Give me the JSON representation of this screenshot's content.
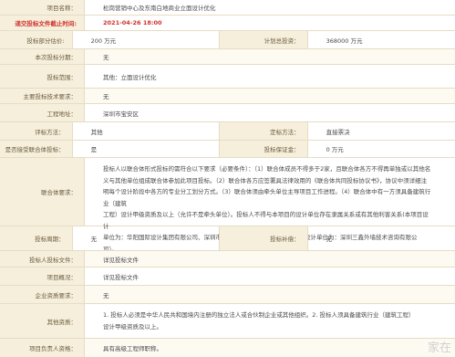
{
  "rows": {
    "project_name": {
      "label": "项目名称：",
      "value": "松岗营销中心及东南白地商业立面设计优化"
    },
    "deadline": {
      "label": "递交投标文件截止时间:",
      "value": "2021-04-26 18:00"
    },
    "estimate": {
      "label": "投标部分估价:",
      "value": "200 万元",
      "label2": "计划总投资：",
      "value2": "368000 万元"
    },
    "divided": {
      "label": "本次投标分期：",
      "value": "无"
    },
    "scope": {
      "label": "投标范围：",
      "value": "其他：立面设计优化"
    },
    "tech_req": {
      "label": "主要投标技术要求：",
      "value": "无"
    },
    "location": {
      "label": "工程地址：",
      "value": "深圳市宝安区"
    },
    "evaluation": {
      "label": "评标方法：",
      "value": "其他",
      "label2": "定标方法：",
      "value2": "直接票决"
    },
    "consortium": {
      "label": "是否接受联合体投标：",
      "value": "是",
      "label2": "投标保证金：",
      "value2": "0 万元"
    },
    "consortium_req": {
      "label": "联合体要求：",
      "lines": [
        "投标人以联合体形式投标的需符合以下要求（必要条件）：（1）联合体成员不得多于2家，且联合体各方不得再单独或以其他名",
        "义与其他单位组成联合体参加此项目投标。（2）联合体各方应签署具法律效用的《联合体共同投标协议书》，协议中须详细注",
        "明每个设计阶段中各方的专业分工划分方式。（3）联合体须由牵头单位主导项目工作进程。（4）联合体中有一方须具备建筑行业（建筑",
        "工程）设计甲级资质及以上（允许不是牵头单位）。投标人不得与本项目的设计单位存在隶属关系或有其他利害关系(本项目设计",
        "单位为：华阳国际设计集团有限公司、深圳市市政设计研究院有限公司；幕墙设计单位为：深圳三鑫外墙技术咨询有限公司）。"
      ]
    },
    "period": {
      "label": "投标周期：",
      "value": "无",
      "label2": "投标补偿：",
      "value2": "无"
    },
    "bid_doc_ref": {
      "label": "投标人投标文件：",
      "value": "详见投标文件"
    },
    "overview": {
      "label": "项目概况：",
      "value": "详见投标文件"
    },
    "qualification": {
      "label": "企业资质要求：",
      "value": "无"
    },
    "other_req": {
      "label": "其他资质：",
      "lines": [
        "1. 投标人必须是中华人民共和国境内注册的独立法人或合伙制企业或其他组织。2. 投标人须具备建筑行业（建筑工程）",
        "设计甲级资质及以上。"
      ]
    },
    "manager": {
      "label": "项目负责人资格：",
      "value": "具有高级工程师职称。"
    }
  },
  "watermark": "家在"
}
